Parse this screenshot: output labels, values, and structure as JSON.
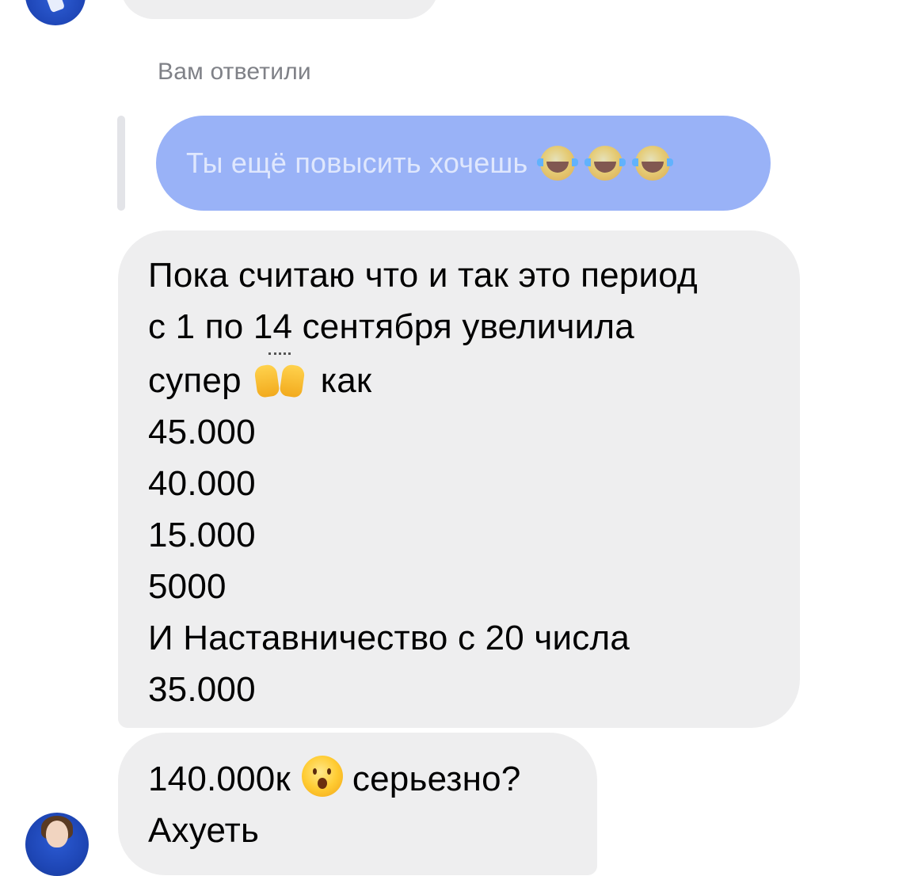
{
  "reply_label": "Вам ответили",
  "quoted_message": {
    "text": "Ты ещё повысить хочешь",
    "emojis": [
      "face-with-tears-of-joy",
      "face-with-tears-of-joy",
      "face-with-tears-of-joy"
    ]
  },
  "main_message": {
    "line1": "Пока считаю что и так это период",
    "line2": "с 1 по 14 сентября увеличила",
    "line3_before": "супер",
    "line3_emoji": "raising-hands",
    "line3_after": "как",
    "line4": "45.000",
    "line5": "40.000",
    "line6": "15.000",
    "line7": "5000",
    "line8": "И Наставничество с 20 числа",
    "line9": "35.000"
  },
  "last_message": {
    "line1_before": "140.000к",
    "line1_emoji": "astonished-face",
    "line1_after": "серьезно?",
    "line2": "Ахуеть"
  },
  "colors": {
    "incoming_bubble": "#eeeeef",
    "quoted_bubble": "#99b2f7",
    "quoted_text": "#dfe7fd",
    "label_text": "#7f8187",
    "avatar_blue": "#1f47b8"
  }
}
